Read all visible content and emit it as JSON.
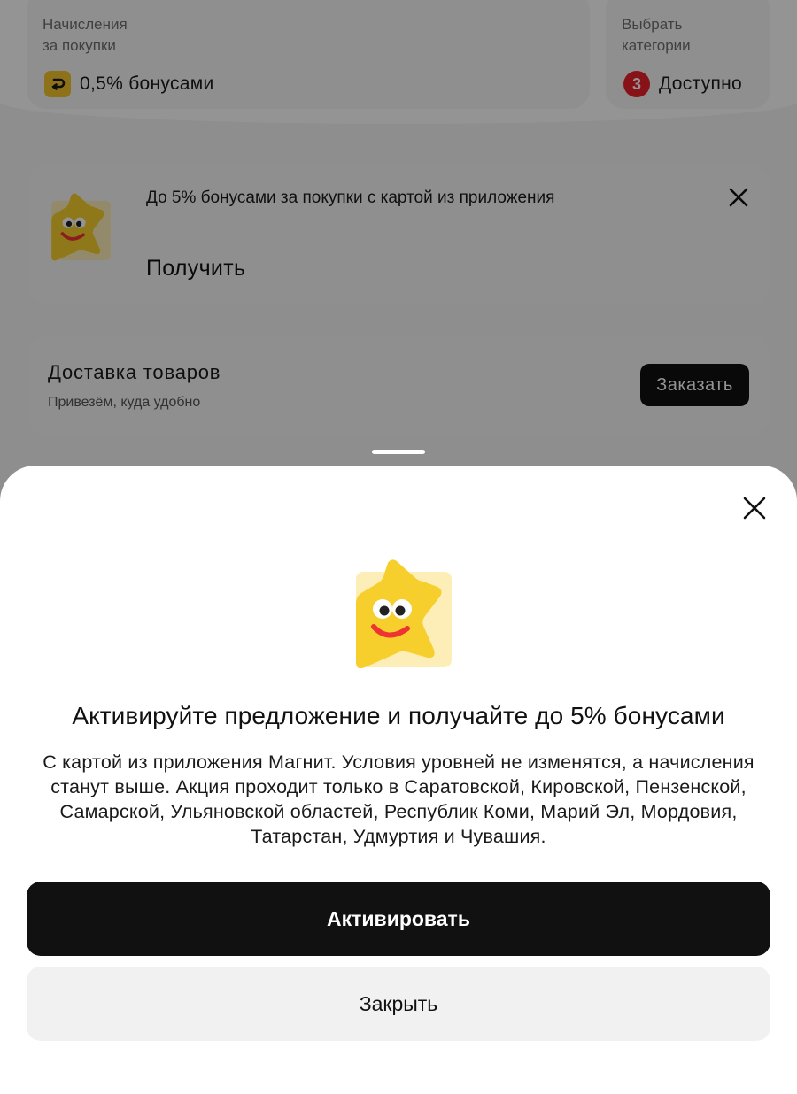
{
  "background": {
    "accrual_card": {
      "title_line1": "Начисления",
      "title_line2": "за покупки",
      "value": "0,5% бонусами"
    },
    "categories_card": {
      "title_line1": "Выбрать",
      "title_line2": "категории",
      "badge_count": "3",
      "value": "Доступно"
    },
    "promo_card": {
      "description": "До 5% бонусами за покупки с картой из приложения",
      "cta": "Получить"
    },
    "delivery_card": {
      "title": "Доставка товаров",
      "subtitle": "Привезём, куда удобно",
      "button": "Заказать"
    }
  },
  "sheet": {
    "title": "Активируйте предложение и получайте до 5% бонусами",
    "body": "С картой из приложения Магнит. Условия уровней не изменятся, а начисления станут выше. Акция проходит только в Саратовской, Кировской, Пензенской, Самарской, Ульяновской областей, Республик Коми, Марий Эл, Мордовия, Татарстан, Удмуртия и Чувашия.",
    "activate_button": "Активировать",
    "close_button": "Закрыть"
  },
  "icons": {
    "star_mascot": "star-mascot-icon",
    "close": "close-icon",
    "bonus": "bonus-icon"
  },
  "colors": {
    "accent_yellow": "#f5c52b",
    "badge_red": "#e8212b",
    "primary_button": "#111111",
    "secondary_button": "#f1f1f1"
  }
}
